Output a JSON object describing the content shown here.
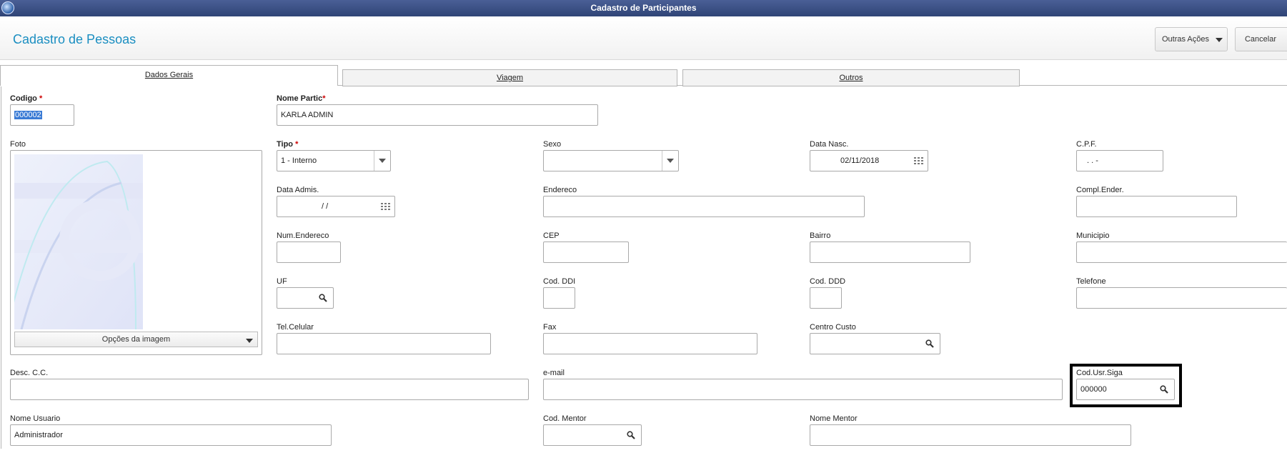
{
  "window": {
    "title": "Cadastro de Participantes"
  },
  "header": {
    "title": "Cadastro de Pessoas",
    "outras_acoes": "Outras Ações",
    "cancelar": "Cancelar"
  },
  "tabs": [
    {
      "label": "Dados Gerais",
      "active": true
    },
    {
      "label": "Viagem",
      "active": false
    },
    {
      "label": "Outros",
      "active": false
    }
  ],
  "required_mark": "*",
  "icons": {
    "app": "app-logo-icon",
    "dropdown": "chevron-down-icon",
    "search": "search-icon",
    "calendar": "calendar-icon"
  },
  "form": {
    "codigo": {
      "label": "Codigo",
      "value": "000002"
    },
    "nome_partic": {
      "label": "Nome Partic",
      "value": "KARLA ADMIN"
    },
    "foto": {
      "label": "Foto",
      "options_button": "Opções da imagem"
    },
    "tipo": {
      "label": "Tipo",
      "value": "1 - Interno"
    },
    "sexo": {
      "label": "Sexo",
      "value": ""
    },
    "data_nasc": {
      "label": "Data Nasc.",
      "value": "02/11/2018"
    },
    "cpf": {
      "label": "C.P.F.",
      "value": ". . -"
    },
    "data_admis": {
      "label": "Data Admis.",
      "value": "/ /"
    },
    "endereco": {
      "label": "Endereco",
      "value": ""
    },
    "compl_ender": {
      "label": "Compl.Ender.",
      "value": ""
    },
    "num_endereco": {
      "label": "Num.Endereco",
      "value": ""
    },
    "cep": {
      "label": "CEP",
      "value": ""
    },
    "bairro": {
      "label": "Bairro",
      "value": ""
    },
    "municipio": {
      "label": "Municipio",
      "value": ""
    },
    "uf": {
      "label": "UF",
      "value": ""
    },
    "cod_ddi": {
      "label": "Cod. DDI",
      "value": ""
    },
    "cod_ddd": {
      "label": "Cod. DDD",
      "value": ""
    },
    "telefone": {
      "label": "Telefone",
      "value": ""
    },
    "tel_celular": {
      "label": "Tel.Celular",
      "value": ""
    },
    "fax": {
      "label": "Fax",
      "value": ""
    },
    "centro_custo": {
      "label": "Centro Custo",
      "value": ""
    },
    "desc_cc": {
      "label": "Desc. C.C.",
      "value": ""
    },
    "email": {
      "label": "e-mail",
      "value": ""
    },
    "cod_usr_siga": {
      "label": "Cod.Usr.Siga",
      "value": "000000"
    },
    "nome_usuario": {
      "label": "Nome Usuario",
      "value": "Administrador"
    },
    "cod_mentor": {
      "label": "Cod. Mentor",
      "value": ""
    },
    "nome_mentor": {
      "label": "Nome Mentor",
      "value": ""
    }
  },
  "colors": {
    "titlebar": "#34497c",
    "title_text": "#1a8ec1",
    "required": "#cc0000",
    "selection": "#3a7bd5"
  }
}
